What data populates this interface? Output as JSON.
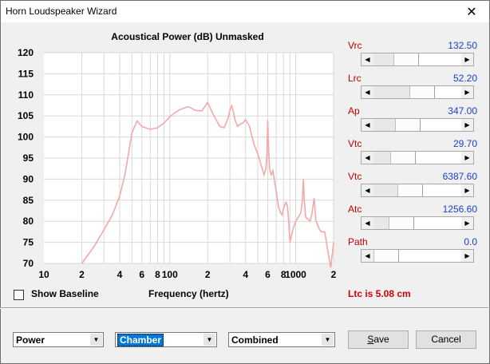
{
  "window": {
    "title": "Horn Loudspeaker Wizard"
  },
  "chart_title": "Acoustical Power (dB)   Unmasked",
  "chart_data": {
    "type": "line",
    "title": "Acoustical Power (dB)   Unmasked",
    "xlabel": "Frequency (hertz)",
    "ylabel": "",
    "x_scale": "log",
    "xlim": [
      10,
      2000
    ],
    "ylim": [
      70,
      120
    ],
    "yticks": [
      "120",
      "115",
      "110",
      "105",
      "100",
      "95",
      "90",
      "85",
      "80",
      "75",
      "70"
    ],
    "xticks": [
      "10",
      "2",
      "4",
      "6",
      "8",
      "100",
      "2",
      "4",
      "6",
      "8",
      "1000",
      "2"
    ],
    "grid": true,
    "series": [
      {
        "color": "#f4a8a8",
        "x": [
          20,
          25,
          30,
          35,
          40,
          44,
          47,
          50,
          55,
          60,
          70,
          80,
          90,
          100,
          110,
          120,
          140,
          160,
          180,
          190,
          200,
          220,
          250,
          270,
          290,
          300,
          310,
          320,
          330,
          345,
          360,
          380,
          400,
          430,
          450,
          470,
          500,
          530,
          560,
          580,
          590,
          600,
          610,
          620,
          640,
          660,
          700,
          730,
          760,
          780,
          800,
          820,
          840,
          860,
          880,
          900,
          950,
          1000,
          1050,
          1100,
          1130,
          1150,
          1170,
          1200,
          1250,
          1300,
          1350,
          1400,
          1450,
          1500,
          1550,
          1600,
          1700,
          1800,
          1900,
          2000
        ],
        "values": [
          70,
          74,
          78,
          81.5,
          86,
          91,
          96,
          101,
          103.8,
          102.5,
          101.8,
          102.2,
          103.3,
          104.8,
          105.8,
          106.5,
          107.2,
          106.3,
          106.2,
          107.2,
          108.2,
          105.5,
          102.5,
          102.2,
          104.4,
          106.3,
          107.4,
          106,
          104,
          102.5,
          103,
          103.3,
          104.1,
          102.5,
          100,
          98,
          96,
          93.5,
          91,
          92.5,
          96,
          104,
          97,
          92.5,
          91,
          92,
          87,
          83.5,
          82,
          81.5,
          83,
          84,
          84.5,
          83.5,
          80,
          75,
          78,
          80,
          81,
          82,
          85,
          90,
          85,
          81,
          80.5,
          80,
          82,
          85.5,
          80,
          79,
          78,
          77.5,
          77.5,
          73,
          69,
          75
        ]
      }
    ]
  },
  "controls": {
    "show_baseline_label": "Show Baseline",
    "frequency_label": "Frequency (hertz)",
    "ltc_text": "Ltc is 5.08 cm"
  },
  "params": [
    {
      "label": "Vrc",
      "value": "132.50",
      "level": 0.32
    },
    {
      "label": "Lrc",
      "value": "52.20",
      "level": 0.58
    },
    {
      "label": "Ap",
      "value": "347.00",
      "level": 0.35
    },
    {
      "label": "Vtc",
      "value": "29.70",
      "level": 0.27
    },
    {
      "label": "Vtc",
      "value": "6387.60",
      "level": 0.38
    },
    {
      "label": "Atc",
      "value": "1256.60",
      "level": 0.24
    },
    {
      "label": "Path",
      "value": "0.0",
      "level": 0.0
    }
  ],
  "combos": [
    {
      "value": "Power"
    },
    {
      "value": "Chamber"
    },
    {
      "value": "Combined"
    }
  ],
  "buttons": {
    "save": "Save",
    "cancel": "Cancel"
  },
  "icons": {
    "close": "close-icon",
    "arrow_left": "scroll-left-icon",
    "arrow_right": "scroll-right-icon",
    "dropdown": "dropdown-arrow-icon"
  }
}
